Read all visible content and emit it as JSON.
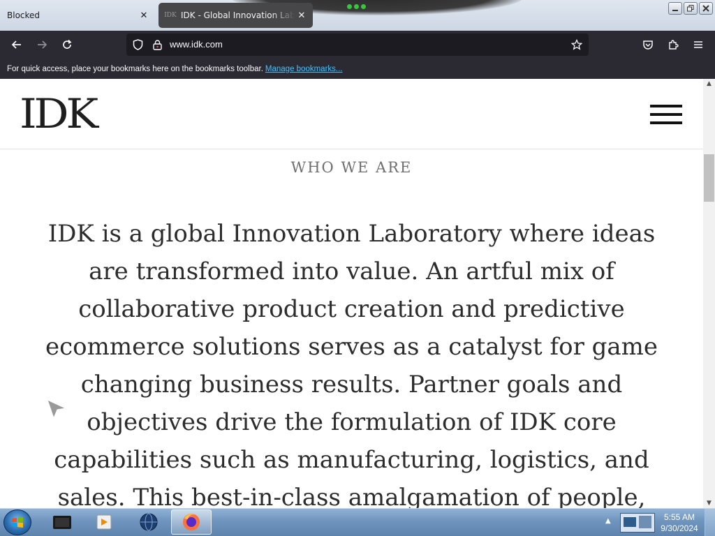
{
  "browser": {
    "tabs": [
      {
        "title": "Blocked",
        "active": false
      },
      {
        "title": "IDK - Global Innovation Laboratory",
        "active": true
      }
    ],
    "url": "www.idk.com",
    "bookmarks_bar": {
      "message": "For quick access, place your bookmarks here on the bookmarks toolbar.",
      "link_label": "Manage bookmarks..."
    },
    "accent_color": "#2b2a33",
    "link_color": "#43c2ff"
  },
  "site": {
    "logo_text": "IDK",
    "section_title": "WHO WE ARE",
    "about_text": "IDK is a global Innovation Laboratory where ideas are transformed into value. An artful mix of collaborative product creation and predictive ecommerce solutions serves as a catalyst for game changing business results. Partner goals and objectives drive the formulation of IDK core capabilities such as manufacturing, logistics, and sales. This best-in-class amalgamation of people,"
  },
  "taskbar": {
    "time": "5:55 AM",
    "date": "9/30/2024",
    "apps": [
      "media-app-icon",
      "player-app-icon",
      "globe-app-icon",
      "firefox-icon"
    ]
  }
}
